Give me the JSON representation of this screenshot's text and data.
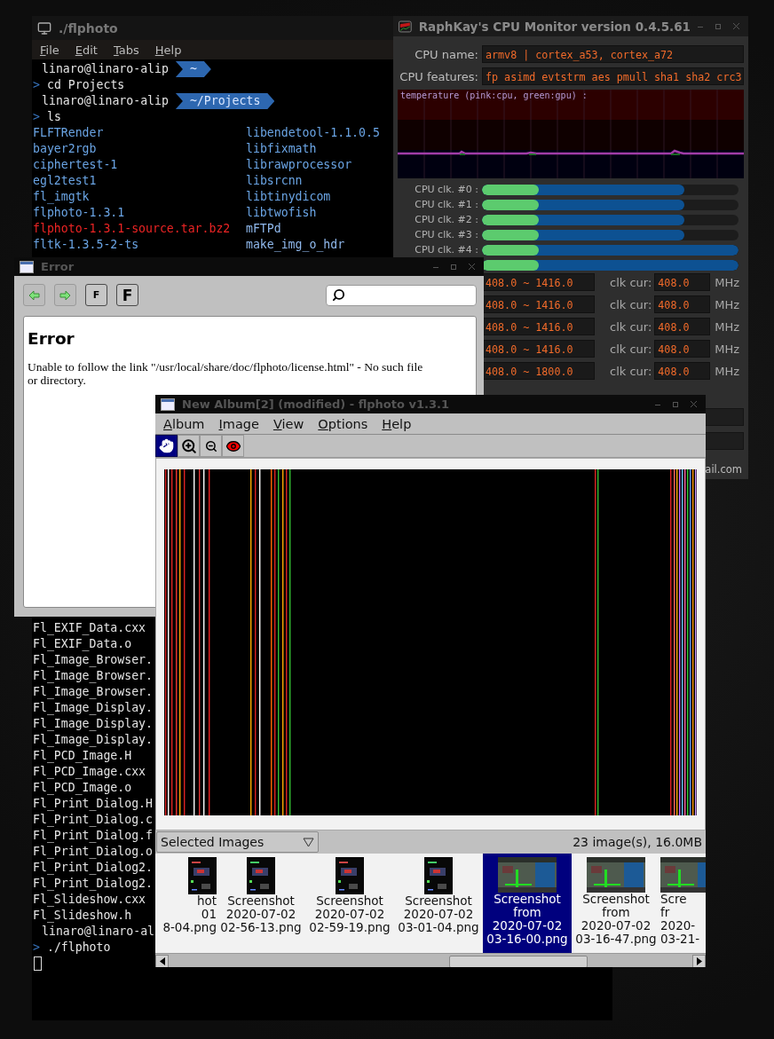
{
  "terminal": {
    "title": "./flphoto",
    "menu": [
      "File",
      "Edit",
      "Tabs",
      "Help"
    ],
    "top_lines": [
      {
        "kind": "prompt",
        "user": "linaro@linaro-alip",
        "path": "~"
      },
      {
        "kind": "command",
        "prompt": ">",
        "text": "cd Projects"
      },
      {
        "kind": "prompt",
        "user": "linaro@linaro-alip",
        "path": "~/Projects"
      },
      {
        "kind": "command",
        "prompt": ">",
        "text": "ls"
      },
      {
        "kind": "listing",
        "cells": [
          {
            "text": "FLFTRender",
            "color": "#6aa4e4"
          },
          {
            "text": "libendetool-1.1.0.5",
            "color": "#6aa4e4"
          }
        ]
      },
      {
        "kind": "listing",
        "cells": [
          {
            "text": "bayer2rgb",
            "color": "#6aa4e4"
          },
          {
            "text": "libfixmath",
            "color": "#6aa4e4"
          }
        ]
      },
      {
        "kind": "listing",
        "cells": [
          {
            "text": "ciphertest-1",
            "color": "#6aa4e4"
          },
          {
            "text": "librawprocessor",
            "color": "#6aa4e4"
          }
        ]
      },
      {
        "kind": "listing",
        "cells": [
          {
            "text": "egl2test1",
            "color": "#6aa4e4"
          },
          {
            "text": "libsrcnn",
            "color": "#6aa4e4"
          }
        ]
      },
      {
        "kind": "listing",
        "cells": [
          {
            "text": "fl_imgtk",
            "color": "#6aa4e4"
          },
          {
            "text": "libtinydicom",
            "color": "#6aa4e4"
          }
        ]
      },
      {
        "kind": "listing",
        "cells": [
          {
            "text": "flphoto-1.3.1",
            "color": "#6aa4e4"
          },
          {
            "text": "libtwofish",
            "color": "#6aa4e4"
          }
        ]
      },
      {
        "kind": "listing",
        "cells": [
          {
            "text": "flphoto-1.3.1-source.tar.bz2",
            "color": "#ec2424"
          },
          {
            "text": "mFTPd",
            "color": "#8fb8ec"
          }
        ]
      },
      {
        "kind": "listing",
        "cells": [
          {
            "text": "fltk-1.3.5-2-ts",
            "color": "#6aa4e4"
          },
          {
            "text": "make_img_o_hdr",
            "color": "#8fb8ec"
          }
        ]
      }
    ],
    "bottom_lines": [
      {
        "kind": "file",
        "text": "Fl_EXIF_Data.cxx"
      },
      {
        "kind": "file",
        "text": "Fl_EXIF_Data.o"
      },
      {
        "kind": "file",
        "text": "Fl_Image_Browser."
      },
      {
        "kind": "file",
        "text": "Fl_Image_Browser."
      },
      {
        "kind": "file",
        "text": "Fl_Image_Browser."
      },
      {
        "kind": "file",
        "text": "Fl_Image_Display."
      },
      {
        "kind": "file",
        "text": "Fl_Image_Display."
      },
      {
        "kind": "file",
        "text": "Fl_Image_Display."
      },
      {
        "kind": "file",
        "text": "Fl_PCD_Image.H"
      },
      {
        "kind": "file",
        "text": "Fl_PCD_Image.cxx"
      },
      {
        "kind": "file",
        "text": "Fl_PCD_Image.o"
      },
      {
        "kind": "file",
        "text": "Fl_Print_Dialog.H"
      },
      {
        "kind": "file",
        "text": "Fl_Print_Dialog.c"
      },
      {
        "kind": "file",
        "text": "Fl_Print_Dialog.f"
      },
      {
        "kind": "file",
        "text": "Fl_Print_Dialog.o"
      },
      {
        "kind": "file",
        "text": "Fl_Print_Dialog2."
      },
      {
        "kind": "file",
        "text": "Fl_Print_Dialog2."
      },
      {
        "kind": "file",
        "text": "Fl_Slideshow.cxx"
      },
      {
        "kind": "file",
        "text": "Fl_Slideshow.h"
      },
      {
        "kind": "prompt",
        "user": "linaro@linaro-al"
      },
      {
        "kind": "command",
        "prompt": ">",
        "text": "./flphoto"
      },
      {
        "kind": "cursor"
      }
    ]
  },
  "cpu_monitor": {
    "title": "RaphKay's CPU Monitor version 0.4.5.61",
    "fields": [
      {
        "label": "CPU name:",
        "value": "armv8 | cortex_a53, cortex_a72"
      },
      {
        "label": "CPU features:",
        "value": "fp asimd evtstrm aes pmull sha1 sha2 crc3"
      }
    ],
    "graph": {
      "caption": "temperature (pink:cpu, green:gpu) :"
    },
    "clocks": [
      {
        "label": "CPU clk. #0 :",
        "current": {
          "level": 0.22
        },
        "range": {
          "level": 0.79
        }
      },
      {
        "label": "CPU clk. #1 :",
        "current": {
          "level": 0.22
        },
        "range": {
          "level": 0.79
        }
      },
      {
        "label": "CPU clk. #2 :",
        "current": {
          "level": 0.22
        },
        "range": {
          "level": 0.79
        }
      },
      {
        "label": "CPU clk. #3 :",
        "current": {
          "level": 0.22
        },
        "range": {
          "level": 0.79
        }
      },
      {
        "label": "CPU clk. #4 :",
        "current": {
          "level": 0.22
        },
        "range": {
          "level": 1
        }
      },
      {
        "current": {
          "level": 0.22
        },
        "range": {
          "level": 1
        }
      }
    ],
    "frequencies": [
      {
        "range": "408.0 ~ 1416.0",
        "label": "clk cur:",
        "value": "408.0",
        "unit": "MHz"
      },
      {
        "range": "408.0 ~ 1416.0",
        "label": "clk cur:",
        "value": "408.0",
        "unit": "MHz"
      },
      {
        "range": "408.0 ~ 1416.0",
        "label": "clk cur:",
        "value": "408.0",
        "unit": "MHz"
      },
      {
        "range": "408.0 ~ 1416.0",
        "label": "clk cur:",
        "value": "408.0",
        "unit": "MHz"
      },
      {
        "range": "408.0 ~ 1800.0",
        "label": "clk cur:",
        "value": "408.0",
        "unit": "MHz"
      }
    ],
    "footer": "ail.com"
  },
  "help_window": {
    "title": "Error",
    "buttons": [
      {
        "kind": "back"
      },
      {
        "kind": "forward"
      },
      {
        "kind": "smaller",
        "label": "F"
      },
      {
        "kind": "larger",
        "label": "F"
      }
    ],
    "heading": "Error",
    "message": "Unable to follow the link \"/usr/local/share/doc/flphoto/license.html\" - No such file or directory."
  },
  "flphoto": {
    "title": "New Album[2] (modified) - flphoto v1.3.1",
    "menu": [
      "Album",
      "Image",
      "View",
      "Options",
      "Help"
    ],
    "tools": [
      {
        "kind": "hand",
        "selected": true
      },
      {
        "kind": "zoom-in",
        "selected": false
      },
      {
        "kind": "zoom-out",
        "selected": false
      },
      {
        "kind": "eye",
        "selected": false
      }
    ],
    "filter": "Selected Images",
    "status": "23 image(s), 16.0MB",
    "thumbnails": [
      {
        "kind": "portrait",
        "selected": false,
        "lines": [
          "hot",
          "01",
          "8-04.png"
        ]
      },
      {
        "kind": "portrait",
        "selected": false,
        "lines": [
          "Screenshot",
          "2020-07-02",
          "02-56-13.png"
        ]
      },
      {
        "kind": "portrait",
        "selected": false,
        "lines": [
          "Screenshot",
          "2020-07-02",
          "02-59-19.png"
        ]
      },
      {
        "kind": "portrait",
        "selected": false,
        "lines": [
          "Screenshot",
          "2020-07-02",
          "03-01-04.png"
        ]
      },
      {
        "kind": "landscape",
        "selected": true,
        "lines": [
          "Screenshot",
          "from",
          "2020-07-02",
          "03-16-00.png"
        ]
      },
      {
        "kind": "landscape",
        "selected": false,
        "lines": [
          "Screenshot",
          "from",
          "2020-07-02",
          "03-16-47.png"
        ]
      },
      {
        "kind": "landscape",
        "selected": false,
        "lines": [
          "Scre",
          "fr",
          "2020-",
          "03-21-"
        ]
      }
    ]
  }
}
